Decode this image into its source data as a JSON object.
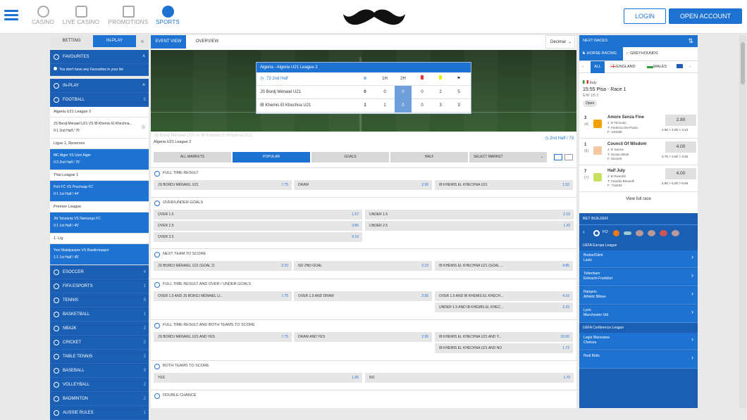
{
  "nav": {
    "items": [
      {
        "label": "CASINO"
      },
      {
        "label": "LIVE CASINO"
      },
      {
        "label": "PROMOTIONS"
      },
      {
        "label": "SPORTS"
      }
    ],
    "login": "LOGIN",
    "open_account": "OPEN ACCOUNT"
  },
  "left": {
    "tabs": [
      "BETTING",
      "IN-PLAY"
    ],
    "collapse": "«",
    "favourites": "FAVOURITES",
    "fav_note": "You don't have any Favourites in your list",
    "inplay": "IN-PLAY",
    "football": {
      "label": "FOOTBALL",
      "count": "5"
    },
    "groups": [
      {
        "league": "Algeria U21 League 2",
        "match": "JS Bordj Ménaiel U21 VS IB Khemis El Khechna...",
        "status": "0:1 2nd Half / 76'",
        "highlight": false
      },
      {
        "league": "Ligue 1, Reserves",
        "match": "MC Alger VS Usm Alger",
        "status": "0:3 2nd Half / 76'",
        "highlight": true
      },
      {
        "league": "Thai League 1",
        "match": "Port FC VS Prachuap FC",
        "status": "0:1 1st Half / 44'",
        "highlight": true
      },
      {
        "league": "Premier League",
        "match": "Jkt Tanzania VS Namungo FC",
        "status": "0:1 1st Half / 45'",
        "highlight": true
      },
      {
        "league": "1. Lig",
        "match": "Yeni Malatyaspor VS Bandirmaspor",
        "status": "1:1 1st Half / 45'",
        "highlight": true
      }
    ],
    "sports": [
      {
        "label": "ESOCCER",
        "count": "4"
      },
      {
        "label": "FIFA ESPORTS",
        "count": "1"
      },
      {
        "label": "TENNIS",
        "count": "8"
      },
      {
        "label": "BASKETBALL",
        "count": "1"
      },
      {
        "label": "NBA2K",
        "count": "2"
      },
      {
        "label": "CRICKET",
        "count": "2"
      },
      {
        "label": "TABLE TENNIS",
        "count": "2"
      },
      {
        "label": "BASEBALL",
        "count": "9"
      },
      {
        "label": "VOLLEYBALL",
        "count": "2"
      },
      {
        "label": "BADMINTON",
        "count": "2"
      },
      {
        "label": "AUSSIE RULES",
        "count": "1"
      }
    ]
  },
  "mid": {
    "tabs": [
      "EVENT VIEW",
      "OVERVIEW"
    ],
    "odds_format": "Decimal",
    "scoreboard": {
      "title": "Algeria - Algeria U21 League 2",
      "period": "73 2nd Half",
      "cols": [
        "1H",
        "2H"
      ],
      "rows": [
        {
          "team": "JS Bordj Ménaiel U21",
          "a": "0",
          "h1": "0",
          "h2": "0",
          "y": "0",
          "c": "2",
          "x": "5"
        },
        {
          "team": "IB Khemis El Khechna U21",
          "a": "1",
          "h1": "1",
          "h2": "0",
          "y": "0",
          "c": "3",
          "x": "3"
        }
      ]
    },
    "event": {
      "title": "JS Bordj Ménaiel U21 vs IB Khemis El Khechna U21",
      "league": "Algeria U21 League 2",
      "clock": "2nd Half / 73"
    },
    "markets": [
      "ALL MARKETS",
      "POPULAR",
      "GOALS",
      "HALF",
      "SELECT MARKET"
    ],
    "sections": [
      {
        "title": "FULL TIME RESULT",
        "odds": [
          [
            "JS BORDJ MÉNAIEL U21",
            "7.75"
          ],
          [
            "DRAW",
            "2.90"
          ],
          [
            "IB KHEMIS EL KHECHNA U21",
            "1.52"
          ]
        ]
      },
      {
        "title": "OVER/UNDER GOALS",
        "odds": [
          [
            "OVER 1.5",
            "1.57"
          ],
          [
            "UNDER 1.5",
            "2.16"
          ],
          [
            "OVER 2.5",
            "3.80"
          ],
          [
            "UNDER 2.5",
            "1.20"
          ],
          [
            "OVER 3.5",
            "9.10"
          ]
        ]
      },
      {
        "title": "NEXT TEAM TO SCORE",
        "odds": [
          [
            "JS BORDJ MÉNAIEL U21 (GOAL 2)",
            "2.20"
          ],
          [
            "NO 2ND GOAL",
            "2.23"
          ],
          [
            "IB KHEMIS EL KHECHNA U21 (GOAL ...",
            "4.85"
          ]
        ]
      },
      {
        "title": "FULL TIME RESULT AND OVER / UNDER GOALS",
        "odds": [
          [
            "OVER 1.5 AND JS BORDJ MÉNAIEL U...",
            "7.75"
          ],
          [
            "OVER 1.5 AND DRAW",
            "2.95"
          ],
          [
            "OVER 1.5 AND IB KHEMIS EL KHECH...",
            "4.10"
          ],
          [
            "UNDER 1.5 AND IB KHEMIS EL KHEC...",
            "2.15"
          ]
        ]
      },
      {
        "title": "FULL TIME RESULT AND BOTH TEAMS TO SCORE",
        "odds": [
          [
            "JS BORDJ MÉNAIEL U21 AND YES",
            "7.75"
          ],
          [
            "DRAW AND YES",
            "2.95"
          ],
          [
            "IB KHEMIS EL KHECHNA U21 AND Y...",
            "10.00"
          ],
          [
            "IB KHEMIS EL KHECHNA U21 AND NO",
            "1.72"
          ]
        ]
      },
      {
        "title": "BOTH TEAMS TO SCORE",
        "odds": [
          [
            "YES",
            "1.95"
          ],
          [
            "NO",
            "1.70"
          ]
        ]
      },
      {
        "title": "DOUBLE CHANCE",
        "odds": []
      }
    ]
  },
  "right": {
    "next_races": "NEXT RACES",
    "tabs": [
      "HORSE RACING",
      "GREYHOUNDS"
    ],
    "filters": [
      "ALL",
      "ENGLAND",
      "WALES"
    ],
    "country": "Italy",
    "race": "15:55 Pisa - Race 1",
    "ew": "E/W 1/5 3",
    "status": "Open",
    "runners": [
      {
        "num": "3",
        "draw": "(4)",
        "name": "Amore Senza Fine",
        "j": "J: D Terzuolo",
        "t": "T: Federico De Paola",
        "id": "F: 230368",
        "price": "2.80",
        "hist": "2.90 > 3.00 > 3.12",
        "silk": "#f0a000"
      },
      {
        "num": "1",
        "draw": "(6)",
        "name": "Council Of Wisdom",
        "j": "J: D Sanna",
        "t": "T: Iacopo Bindi",
        "id": "F: 524115",
        "price": "4.00",
        "hist": "3.75 > 3.50 > 3.50",
        "silk": "#f2c8a0"
      },
      {
        "num": "7",
        "draw": "(7)",
        "name": "Half July",
        "j": "J: B Riverditi",
        "t": "T: Claudio Binarelli",
        "id": "F: 716493",
        "price": "4.00",
        "hist": "4.50 > 5.00 > 5.55",
        "silk": "#c8e060"
      }
    ],
    "view_full": "View full race",
    "bet_builder": "BET BUILDER",
    "bb_sport": "FO",
    "competitions": [
      {
        "name": "UEFA Europa League",
        "matches": [
          [
            "Bodoe/Glimt",
            "Lazio"
          ],
          [
            "Tottenham",
            "Eintracht Frankfurt"
          ],
          [
            "Rangers",
            "Athletic Bilbao"
          ],
          [
            "Lyon",
            "Manchester Utd"
          ]
        ]
      },
      {
        "name": "UEFA Conference League",
        "matches": [
          [
            "Legia Warszawa",
            "Chelsea"
          ],
          [
            "Real Betis",
            ""
          ]
        ]
      }
    ]
  }
}
